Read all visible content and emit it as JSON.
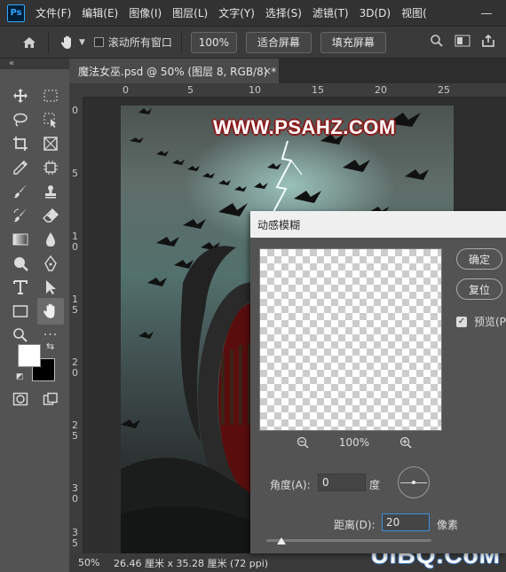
{
  "app": {
    "logo": "Ps"
  },
  "menu": [
    "文件(F)",
    "编辑(E)",
    "图像(I)",
    "图层(L)",
    "文字(Y)",
    "选择(S)",
    "滤镜(T)",
    "3D(D)",
    "视图("
  ],
  "options_bar": {
    "scroll_all_windows": "滚动所有窗口",
    "zoom_value": "100%",
    "fit_screen": "适合屏幕",
    "fill_screen": "填充屏幕"
  },
  "document": {
    "tab_title": "魔法女巫.psd @ 50% (图层 8, RGB/8) *",
    "close_glyph": "×"
  },
  "rulers": {
    "horizontal": [
      "0",
      "5",
      "10",
      "15",
      "20",
      "25"
    ],
    "vertical": [
      "0",
      "5",
      "1",
      "1",
      "2",
      "2",
      "3",
      "3"
    ],
    "vertical_tail": [
      "0",
      "5",
      "0",
      "5",
      "0",
      "5"
    ]
  },
  "canvas": {
    "watermark": "WWW.PSAHZ.COM"
  },
  "status_bar": {
    "zoom": "50%",
    "doc_info": "26.46 厘米 x 35.28 厘米 (72 ppi)"
  },
  "site_watermark": "UiBQ.CoM",
  "dialog": {
    "title": "动感模糊",
    "ok": "确定",
    "reset": "复位",
    "preview_label": "预览(P",
    "preview_checked": true,
    "zoom": "100%",
    "angle_label": "角度(A):",
    "angle_value": "0",
    "angle_unit": "度",
    "distance_label": "距离(D):",
    "distance_value": "20",
    "distance_unit": "像素",
    "distance_slider_fraction": 0.09
  },
  "colors": {
    "foreground": "#ffffff",
    "background": "#000000",
    "focus": "#3b8de0"
  },
  "icons": [
    "home-icon",
    "hand-icon",
    "search-icon",
    "screen-mode-icon",
    "share-icon",
    "move-icon",
    "marquee-icon",
    "lasso-icon",
    "object-select-icon",
    "crop-icon",
    "frame-icon",
    "eyedropper-icon",
    "healing-icon",
    "brush-icon",
    "stamp-icon",
    "history-brush-icon",
    "eraser-icon",
    "gradient-icon",
    "blur-icon",
    "dodge-icon",
    "pen-icon",
    "type-icon",
    "path-select-icon",
    "rectangle-icon",
    "zoom-icon",
    "quick-mask-icon",
    "screen-mode-icon",
    "zoom-out-icon",
    "zoom-in-icon"
  ]
}
